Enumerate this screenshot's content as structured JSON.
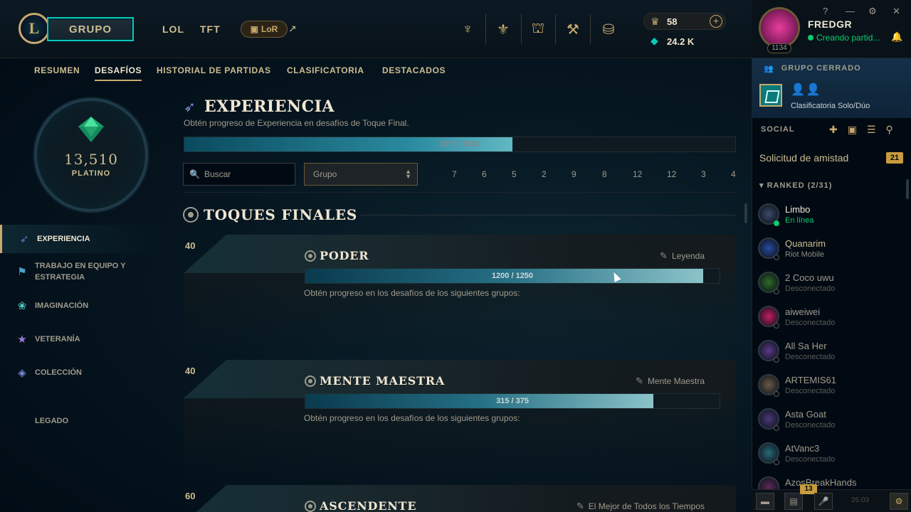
{
  "topbar": {
    "play_label": "GRUPO",
    "nav": [
      "LOL",
      "TFT"
    ],
    "lor_label": "LoR",
    "rp": "58",
    "be": "24.2 K",
    "icons": [
      "trophy-icon",
      "tournament-icon",
      "store-icon",
      "loot-icon",
      "collection-icon"
    ]
  },
  "profile": {
    "name": "FREDGR",
    "status": "Creando partid...",
    "level": "1134"
  },
  "subnav": {
    "tabs": [
      "RESUMEN",
      "DESAFÍOS",
      "HISTORIAL DE PARTIDAS",
      "CLASIFICATORIA",
      "DESTACADOS"
    ],
    "active": "DESAFÍOS"
  },
  "sidebar": {
    "points": "13,510",
    "rank": "PLATINO",
    "categories": [
      {
        "label": "EXPERIENCIA",
        "icon": "experience-icon"
      },
      {
        "label": "TRABAJO EN EQUIPO Y ESTRATEGIA",
        "icon": "teamwork-icon"
      },
      {
        "label": "IMAGINACIÓN",
        "icon": "imagination-icon"
      },
      {
        "label": "VETERANÍA",
        "icon": "veterancy-icon"
      },
      {
        "label": "COLECCIÓN",
        "icon": "collection-icon"
      },
      {
        "label": "LEGADO",
        "icon": ""
      }
    ]
  },
  "main": {
    "title": "EXPERIENCIA",
    "description": "Obtén progreso de Experiencia en desafíos de Toque Final.",
    "progress_text": "3275 / 5500",
    "progress_fraction": 0.595,
    "search_placeholder": "Buscar",
    "group_select": "Grupo",
    "filter_counts": [
      "7",
      "6",
      "5",
      "2",
      "9",
      "8",
      "12",
      "12",
      "3",
      "4"
    ],
    "group_title": "TOQUES FINALES",
    "cards": [
      {
        "points": "40",
        "title": "PODER",
        "reward": "Leyenda",
        "progress_text": "1200 / 1250",
        "progress_fraction": 0.96,
        "desc": "Obtén progreso en los desafíos de los siguientes grupos:"
      },
      {
        "points": "40",
        "title": "MENTE MAESTRA",
        "reward": "Mente Maestra",
        "progress_text": "315 / 375",
        "progress_fraction": 0.84,
        "desc": "Obtén progreso en los desafíos de los siguientes grupos:"
      },
      {
        "points": "60",
        "title": "ASCENDENTE",
        "reward": "El Mejor de Todos los Tiempos",
        "progress_text": "",
        "progress_fraction": 0,
        "desc": ""
      }
    ]
  },
  "social": {
    "lobby_header": "GRUPO CERRADO",
    "lobby_queue": "Clasificatoria Solo/Dúo",
    "header": "SOCIAL",
    "friend_request_label": "Solicitud de amistad",
    "friend_request_count": "21",
    "group_header": "RANKED (2/31)",
    "friends": [
      {
        "name": "Limbo",
        "status": "En línea",
        "state": "online",
        "color": "#3b4a6a"
      },
      {
        "name": "Quanarim",
        "status": "Riot Mobile",
        "state": "mobile",
        "color": "#2a4aa0"
      },
      {
        "name": "2 Coco uwu",
        "status": "Desconectado",
        "state": "offline",
        "color": "#2f6a2a"
      },
      {
        "name": "aiweiwei",
        "status": "Desconectado",
        "state": "offline",
        "color": "#c01e63"
      },
      {
        "name": "All Sa Her",
        "status": "Desconectado",
        "state": "offline",
        "color": "#5a3a8a"
      },
      {
        "name": "ARTEMIS61",
        "status": "Desconectado",
        "state": "offline",
        "color": "#6a5a4a"
      },
      {
        "name": "Asta Goat",
        "status": "Desconectado",
        "state": "offline",
        "color": "#4a3a7a"
      },
      {
        "name": "AtVanc3",
        "status": "Desconectado",
        "state": "offline",
        "color": "#2a6a7a"
      },
      {
        "name": "AzosBreakHands",
        "status": "",
        "state": "offline",
        "color": "#5a2a5a"
      }
    ],
    "bottom_badge": "13",
    "version": "26.03"
  }
}
